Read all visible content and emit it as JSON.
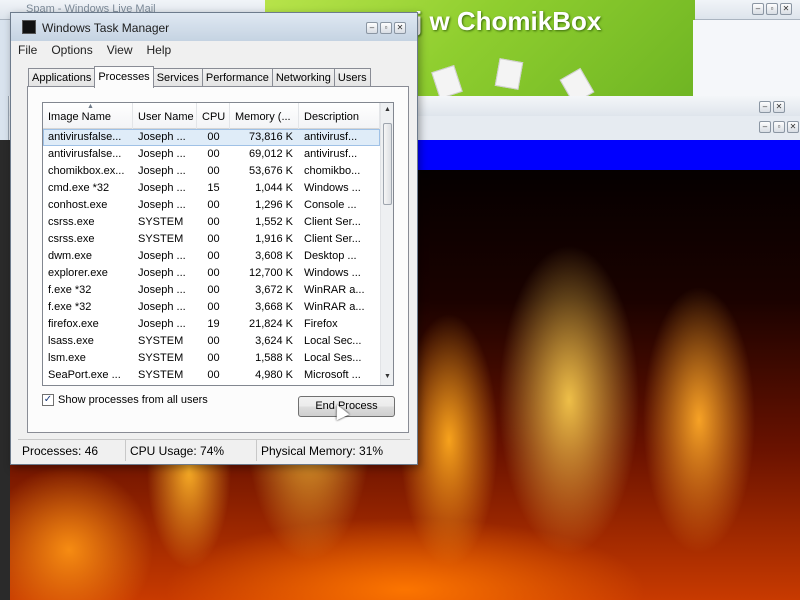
{
  "background": {
    "mail_window_title": "Spam - Windows Live Mail",
    "chomik_banner_text": "j w ChomikBox"
  },
  "taskmanager": {
    "title": "Windows Task Manager",
    "menu": [
      "File",
      "Options",
      "View",
      "Help"
    ],
    "tabs": [
      "Applications",
      "Processes",
      "Services",
      "Performance",
      "Networking",
      "Users"
    ],
    "active_tab": "Processes",
    "columns": [
      "Image Name",
      "User Name",
      "CPU",
      "Memory (...",
      "Description"
    ],
    "rows": [
      {
        "image": "antivirusfalse...",
        "user": "Joseph ...",
        "cpu": "00",
        "mem": "73,816 K",
        "desc": "antivirusf..."
      },
      {
        "image": "antivirusfalse...",
        "user": "Joseph ...",
        "cpu": "00",
        "mem": "69,012 K",
        "desc": "antivirusf..."
      },
      {
        "image": "chomikbox.ex...",
        "user": "Joseph ...",
        "cpu": "00",
        "mem": "53,676 K",
        "desc": "chomikbo..."
      },
      {
        "image": "cmd.exe *32",
        "user": "Joseph ...",
        "cpu": "15",
        "mem": "1,044 K",
        "desc": "Windows ..."
      },
      {
        "image": "conhost.exe",
        "user": "Joseph ...",
        "cpu": "00",
        "mem": "1,296 K",
        "desc": "Console ..."
      },
      {
        "image": "csrss.exe",
        "user": "SYSTEM",
        "cpu": "00",
        "mem": "1,552 K",
        "desc": "Client Ser..."
      },
      {
        "image": "csrss.exe",
        "user": "SYSTEM",
        "cpu": "00",
        "mem": "1,916 K",
        "desc": "Client Ser..."
      },
      {
        "image": "dwm.exe",
        "user": "Joseph ...",
        "cpu": "00",
        "mem": "3,608 K",
        "desc": "Desktop ..."
      },
      {
        "image": "explorer.exe",
        "user": "Joseph ...",
        "cpu": "00",
        "mem": "12,700 K",
        "desc": "Windows ..."
      },
      {
        "image": "f.exe *32",
        "user": "Joseph ...",
        "cpu": "00",
        "mem": "3,672 K",
        "desc": "WinRAR a..."
      },
      {
        "image": "f.exe *32",
        "user": "Joseph ...",
        "cpu": "00",
        "mem": "3,668 K",
        "desc": "WinRAR a..."
      },
      {
        "image": "firefox.exe",
        "user": "Joseph ...",
        "cpu": "19",
        "mem": "21,824 K",
        "desc": "Firefox"
      },
      {
        "image": "lsass.exe",
        "user": "SYSTEM",
        "cpu": "00",
        "mem": "3,624 K",
        "desc": "Local Sec..."
      },
      {
        "image": "lsm.exe",
        "user": "SYSTEM",
        "cpu": "00",
        "mem": "1,588 K",
        "desc": "Local Ses..."
      },
      {
        "image": "SeaPort.exe ...",
        "user": "SYSTEM",
        "cpu": "00",
        "mem": "4,980 K",
        "desc": "Microsoft ..."
      }
    ],
    "selected_row": 0,
    "show_all_label": "Show processes from all users",
    "show_all_checked": true,
    "end_process_label": "End Process",
    "status": {
      "processes": "Processes: 46",
      "cpu": "CPU Usage: 74%",
      "memory": "Physical Memory: 31%"
    }
  },
  "icons": {
    "window_minimize": "minimize-icon",
    "window_maximize": "maximize-icon",
    "window_close": "close-icon",
    "sort": "sort-ascending-icon",
    "checkbox": "checkmark-icon"
  },
  "colors": {
    "selection": "#dfecf8",
    "titlebar": "#c5d3e2",
    "chomik_green": "#8fce2f",
    "video_blue": "#0000ff"
  }
}
